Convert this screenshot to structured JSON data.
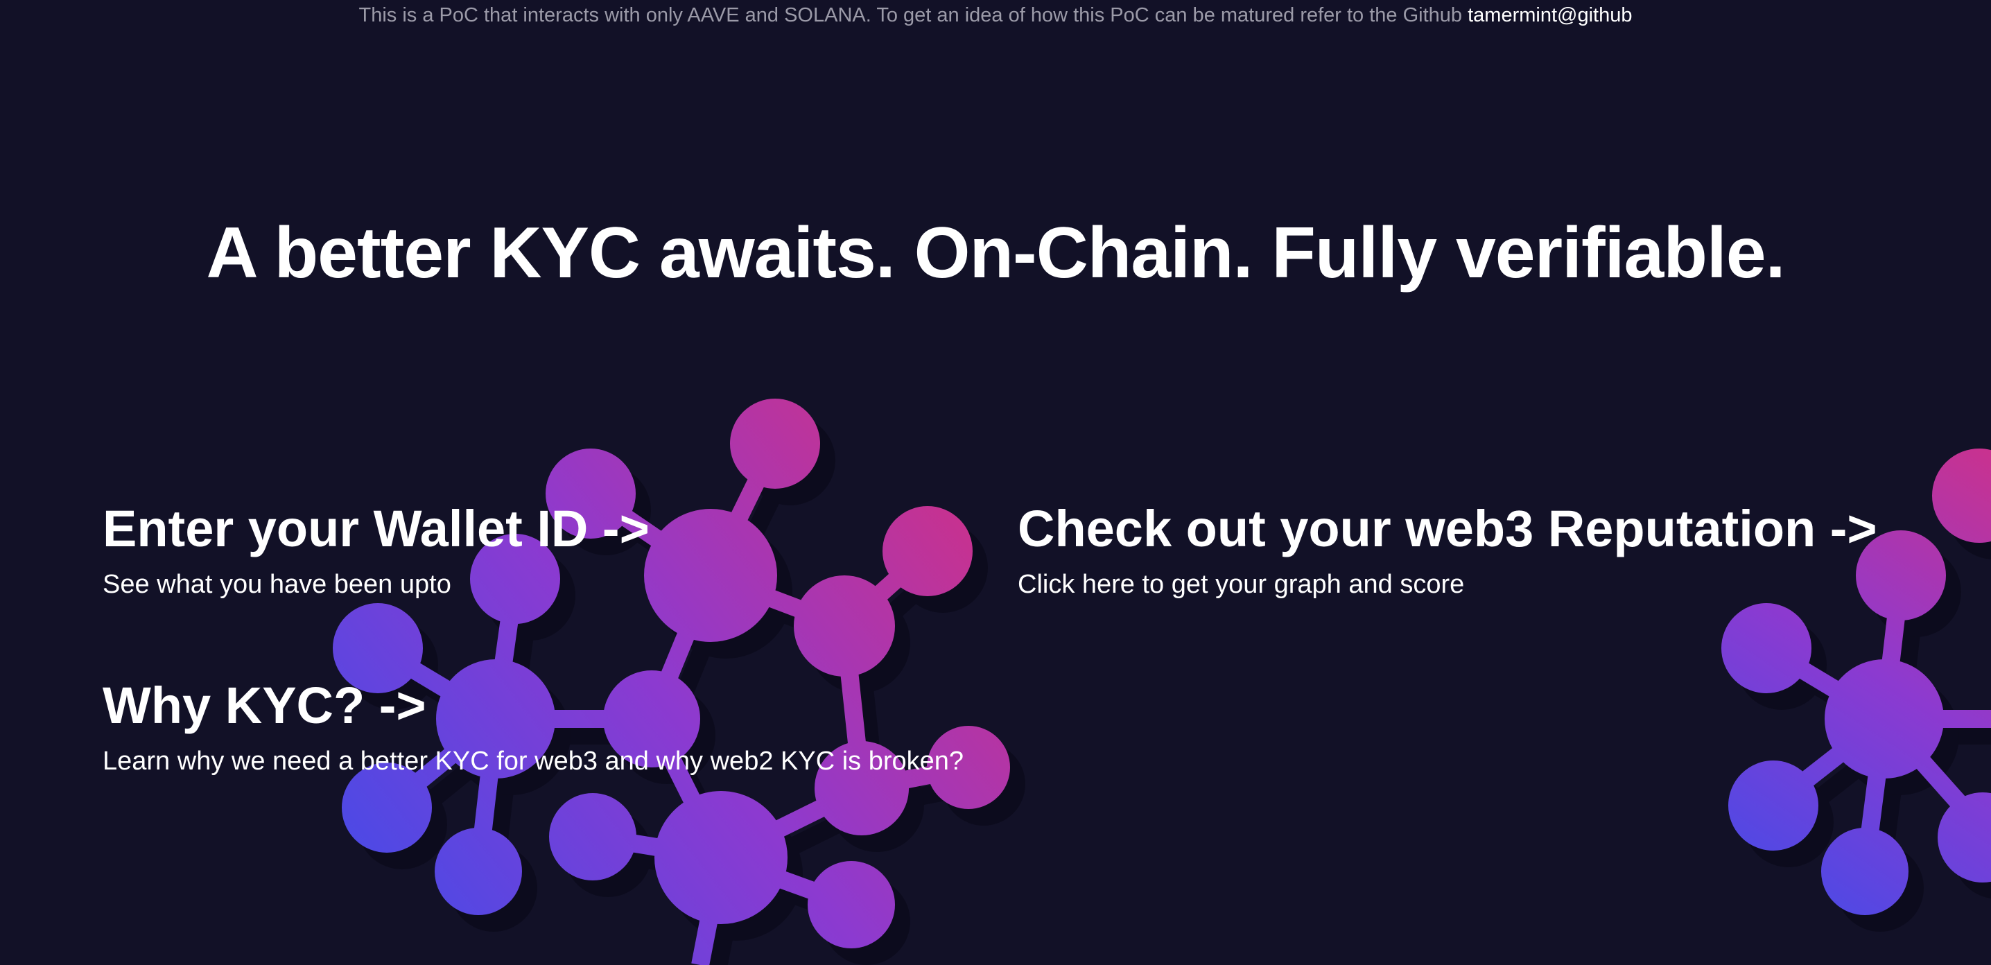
{
  "banner": {
    "text": "This is a PoC that interacts with only AAVE and SOLANA. To get an idea of how this PoC can be matured refer to the Github ",
    "link_label": "tamermint@github"
  },
  "hero": {
    "title": "A better KYC awaits. On-Chain. Fully verifiable."
  },
  "cards": [
    {
      "title": "Enter your Wallet ID ->",
      "description": "See what you have been upto"
    },
    {
      "title": "Check out your web3 Reputation ->",
      "description": "Click here to get your graph and score"
    },
    {
      "title": "Why KYC? ->",
      "description": "Learn why we need a better KYC for web3 and why web2 KYC is broken?"
    }
  ],
  "theme": {
    "background": "#121127",
    "muted_text": "#9b9aa8",
    "gradient_blue": "#4a4ae6",
    "gradient_purple": "#8c3ad0",
    "gradient_pink": "#d6307f"
  },
  "decorations": [
    "molecule-graphic-left",
    "molecule-graphic-right"
  ]
}
